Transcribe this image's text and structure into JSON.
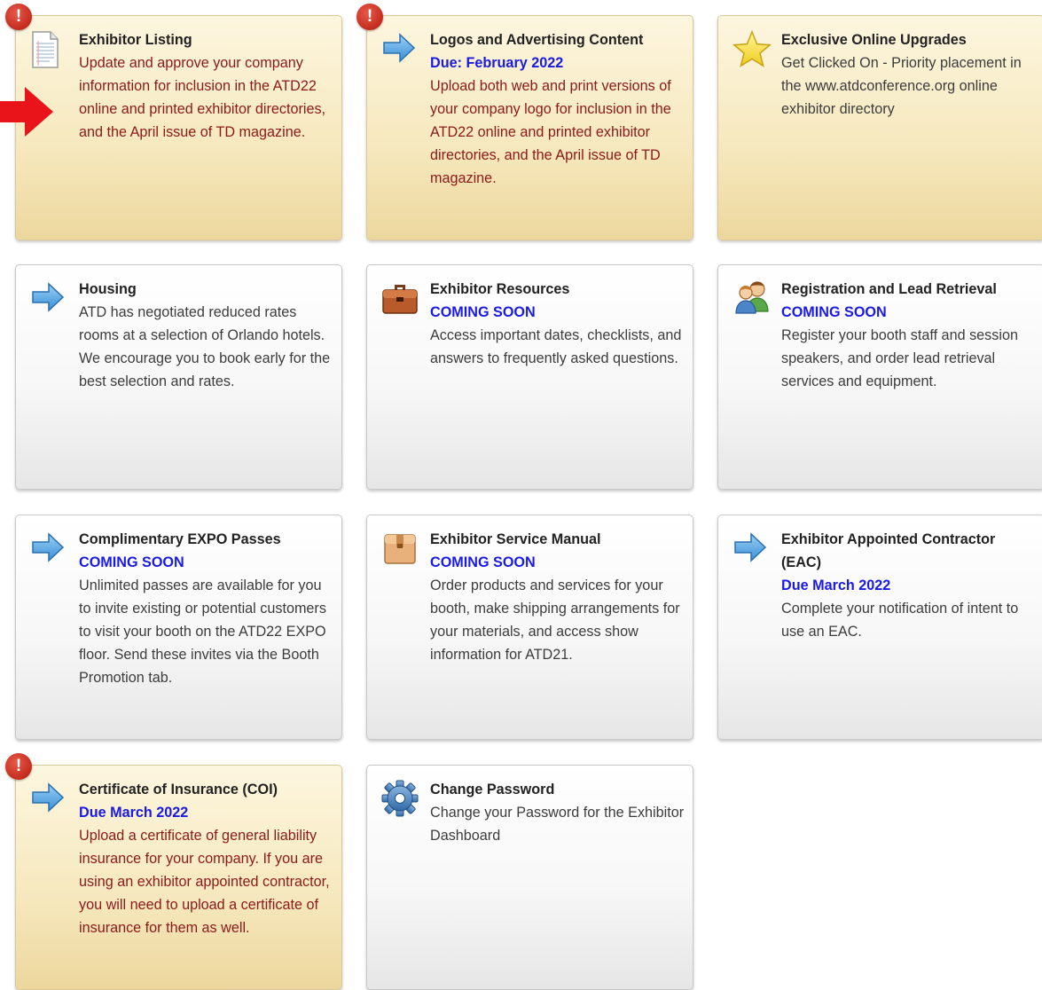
{
  "cards": [
    {
      "title": "Exhibitor Listing",
      "due": "",
      "description": "Update and approve your company information for inclusion in the ATD22 online and printed exhibitor directories, and the April issue of TD magazine.",
      "icon": "document-icon",
      "alert": true,
      "highlighted": true
    },
    {
      "title": "Logos and Advertising Content",
      "due": "Due: February 2022",
      "description": "Upload both web and print versions of your company logo for inclusion in the ATD22 online and printed exhibitor directories, and the April issue of TD magazine.",
      "icon": "arrow-right-icon",
      "alert": true,
      "highlighted": true
    },
    {
      "title": "Exclusive Online Upgrades",
      "due": "",
      "description": "Get Clicked On - Priority placement in the www.atdconference.org online exhibitor directory",
      "icon": "star-icon",
      "alert": false,
      "highlighted": true
    },
    {
      "title": "Housing",
      "due": "",
      "description": "ATD has negotiated reduced rates rooms at a selection of Orlando hotels. We encourage you to book early for the best selection and rates.",
      "icon": "arrow-right-icon",
      "alert": false,
      "highlighted": false
    },
    {
      "title": "Exhibitor Resources",
      "due": "COMING SOON",
      "description": "Access important dates, checklists, and answers to frequently asked questions.",
      "icon": "briefcase-icon",
      "alert": false,
      "highlighted": false
    },
    {
      "title": "Registration and Lead Retrieval",
      "due": "COMING SOON",
      "description": "Register your booth staff and session speakers, and order lead retrieval services and equipment.",
      "icon": "users-icon",
      "alert": false,
      "highlighted": false
    },
    {
      "title": "Complimentary EXPO Passes",
      "due": "COMING SOON",
      "description": "Unlimited passes are available for you to invite existing or potential customers to visit your booth on the ATD22 EXPO floor. Send these invites via the Booth Promotion tab.",
      "icon": "arrow-right-icon",
      "alert": false,
      "highlighted": false
    },
    {
      "title": "Exhibitor Service Manual",
      "due": "COMING SOON",
      "description": "Order products and services for your booth, make shipping arrangements for your materials, and access show information for ATD21.",
      "icon": "box-icon",
      "alert": false,
      "highlighted": false
    },
    {
      "title": "Exhibitor Appointed Contractor (EAC)",
      "due": "Due March 2022",
      "description": "Complete your notification of intent to use an EAC.",
      "icon": "arrow-right-icon",
      "alert": false,
      "highlighted": false
    },
    {
      "title": "Certificate of Insurance (COI)",
      "due": "Due March 2022",
      "description": "Upload a certificate of general liability insurance for your company. If you are using an exhibitor appointed contractor, you will need to upload a certificate of insurance for them as well.",
      "icon": "arrow-right-icon",
      "alert": true,
      "highlighted": true
    },
    {
      "title": "Change Password",
      "due": "",
      "description": "Change your Password for the Exhibitor Dashboard",
      "icon": "gear-icon",
      "alert": false,
      "highlighted": false
    }
  ],
  "alert_glyph": "!",
  "colors": {
    "due_text": "#1a1ae6",
    "highlight_description": "#8b1a1a",
    "alert_badge": "#c2281a",
    "pointer_arrow": "#e8141a"
  }
}
